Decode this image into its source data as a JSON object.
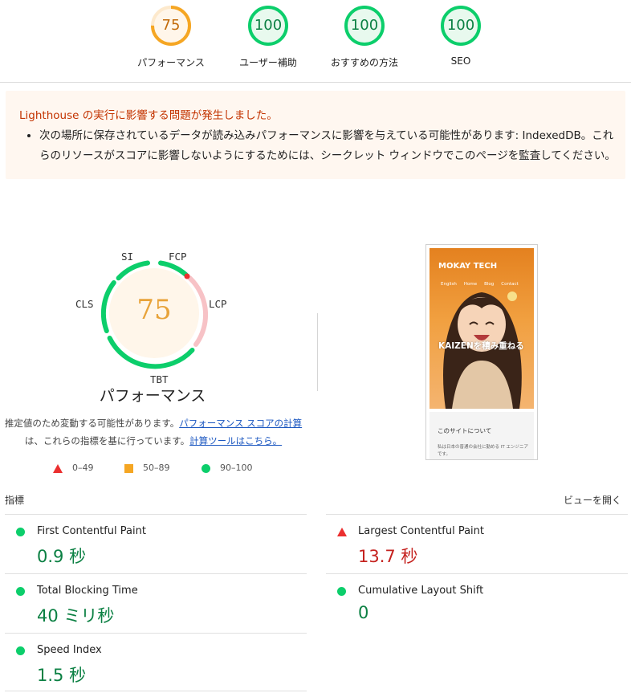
{
  "top_gauges": [
    {
      "score": "75",
      "label": "パフォーマンス",
      "score_fraction": 0.75,
      "color": "#f5a623"
    },
    {
      "score": "100",
      "label": "ユーザー補助",
      "score_fraction": 1.0,
      "color": "#0cce6b"
    },
    {
      "score": "100",
      "label": "おすすめの方法",
      "score_fraction": 1.0,
      "color": "#0cce6b"
    },
    {
      "score": "100",
      "label": "SEO",
      "score_fraction": 1.0,
      "color": "#0cce6b"
    }
  ],
  "warning": {
    "title": "Lighthouse の実行に影響する問題が発生しました。",
    "item": "次の場所に保存されているデータが読み込みパフォーマンスに影響を与えている可能性があります: IndexedDB。これらのリソースがスコアに影響しないようにするためには、シークレット ウィンドウでこのページを監査してください。"
  },
  "performance": {
    "score": "75",
    "title": "パフォーマンス",
    "tags": {
      "si": "SI",
      "fcp": "FCP",
      "lcp": "LCP",
      "tbt": "TBT",
      "cls": "CLS"
    },
    "desc_prefix": "推定値のため変動する可能性があります。",
    "desc_link1": "パフォーマンス スコアの計算",
    "desc_mid": "は、これらの指標を基に行っています。",
    "desc_link2": "計算ツールはこちら。"
  },
  "legend": [
    {
      "shape": "triangle",
      "label": "0–49",
      "color": "#eb2f2f"
    },
    {
      "shape": "square",
      "label": "50–89",
      "color": "#f5a623"
    },
    {
      "shape": "circle",
      "label": "90–100",
      "color": "#0cce6b"
    }
  ],
  "screenshot": {
    "site_title": "MOKAY TECH",
    "nav": [
      "English",
      "Home",
      "Blog",
      "Contact"
    ],
    "tagline": "KAIZENを積み重ねる",
    "about_heading": "このサイトについて",
    "about_text": "私は日本の普通の会社に勤める IT エンジニアです。"
  },
  "metrics": {
    "header": "指標",
    "expand": "ビューを開く",
    "items": [
      {
        "name": "First Contentful Paint",
        "value": "0.9 秒",
        "status": "good"
      },
      {
        "name": "Largest Contentful Paint",
        "value": "13.7 秒",
        "status": "poor"
      },
      {
        "name": "Total Blocking Time",
        "value": "40 ミリ秒",
        "status": "good"
      },
      {
        "name": "Cumulative Layout Shift",
        "value": "0",
        "status": "good"
      },
      {
        "name": "Speed Index",
        "value": "1.5 秒",
        "status": "good"
      }
    ]
  },
  "colors": {
    "good": "#0cce6b",
    "average": "#f5a623",
    "poor": "#eb2f2f"
  }
}
